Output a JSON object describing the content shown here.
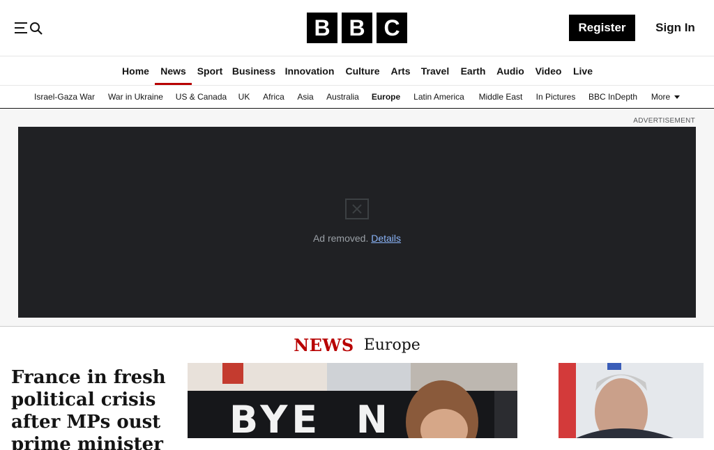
{
  "header": {
    "logo_letters": [
      "B",
      "B",
      "C"
    ],
    "register_label": "Register",
    "signin_label": "Sign In"
  },
  "primary_nav": [
    {
      "label": "Home"
    },
    {
      "label": "News"
    },
    {
      "label": "Sport"
    },
    {
      "label": "Business"
    },
    {
      "label": "Innovation"
    },
    {
      "label": "Culture"
    },
    {
      "label": "Arts"
    },
    {
      "label": "Travel"
    },
    {
      "label": "Earth"
    },
    {
      "label": "Audio"
    },
    {
      "label": "Video"
    },
    {
      "label": "Live"
    }
  ],
  "primary_nav_active": "News",
  "secondary_nav": [
    {
      "label": "Israel-Gaza War"
    },
    {
      "label": "War in Ukraine"
    },
    {
      "label": "US & Canada"
    },
    {
      "label": "UK"
    },
    {
      "label": "Africa"
    },
    {
      "label": "Asia"
    },
    {
      "label": "Australia"
    },
    {
      "label": "Europe"
    },
    {
      "label": "Latin America"
    },
    {
      "label": "Middle East"
    },
    {
      "label": "In Pictures"
    },
    {
      "label": "BBC InDepth"
    },
    {
      "label": "More"
    }
  ],
  "secondary_nav_active": "Europe",
  "ad": {
    "label": "ADVERTISEMENT",
    "removed_text": "Ad removed.",
    "details_link": "Details"
  },
  "section": {
    "brand": "NEWS",
    "region": "Europe"
  },
  "lead_story": {
    "headline": "France in fresh political crisis after MPs oust prime minister",
    "image_text": "BYE  N"
  },
  "colors": {
    "brand_red": "#b80000",
    "ad_background": "#202124",
    "link_blue": "#8ab4f8"
  },
  "icons": [
    "menu-icon",
    "search-icon",
    "ad-removed-icon",
    "chevron-down-icon"
  ]
}
